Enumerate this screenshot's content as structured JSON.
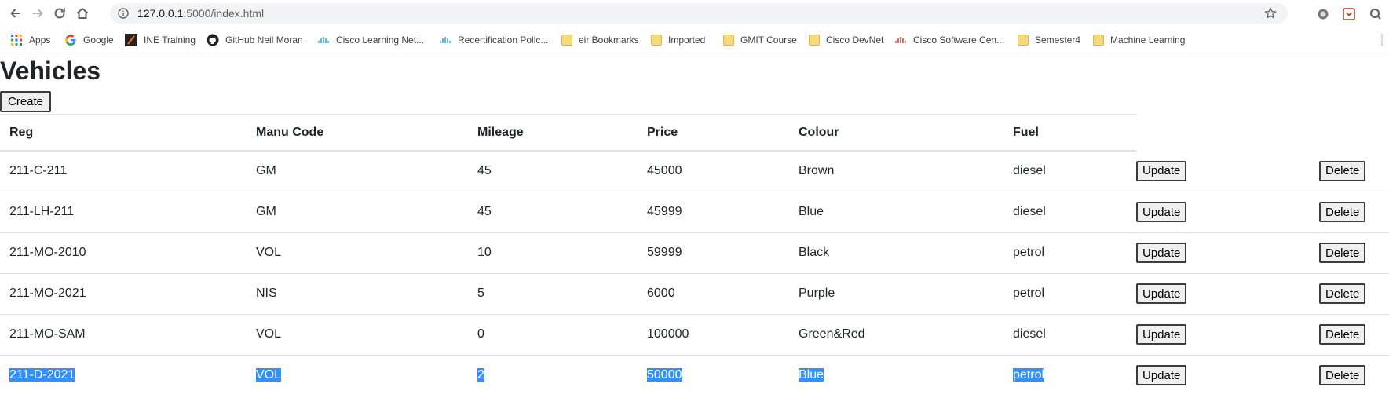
{
  "browser": {
    "url_host": "127.0.0.1",
    "url_rest": ":5000/index.html",
    "bookmarks": [
      {
        "label": "Apps",
        "icon": "apps-grid-icon"
      },
      {
        "label": "Google",
        "icon": "google-icon"
      },
      {
        "label": "INE Training",
        "icon": "ine-icon"
      },
      {
        "label": "GitHub Neil Moran",
        "icon": "github-icon"
      },
      {
        "label": "Cisco Learning Net...",
        "icon": "cisco-icon"
      },
      {
        "label": "Recertification Polic...",
        "icon": "cisco-icon"
      },
      {
        "label": "eir Bookmarks",
        "icon": "folder-icon"
      },
      {
        "label": "Imported",
        "icon": "folder-icon"
      },
      {
        "label": "GMIT Course",
        "icon": "folder-icon"
      },
      {
        "label": "Cisco DevNet",
        "icon": "folder-icon"
      },
      {
        "label": "Cisco Software Cen...",
        "icon": "cisco-icon"
      },
      {
        "label": "Semester4",
        "icon": "folder-icon"
      },
      {
        "label": "Machine Learning",
        "icon": "folder-icon"
      }
    ]
  },
  "page": {
    "title": "Vehicles",
    "create_label": "Create",
    "columns": [
      "Reg",
      "Manu Code",
      "Mileage",
      "Price",
      "Colour",
      "Fuel"
    ],
    "update_label": "Update",
    "delete_label": "Delete",
    "rows": [
      {
        "reg": "211-C-211",
        "manu": "GM",
        "mileage": "45",
        "price": "45000",
        "colour": "Brown",
        "fuel": "diesel"
      },
      {
        "reg": "211-LH-211",
        "manu": "GM",
        "mileage": "45",
        "price": "45999",
        "colour": "Blue",
        "fuel": "diesel"
      },
      {
        "reg": "211-MO-2010",
        "manu": "VOL",
        "mileage": "10",
        "price": "59999",
        "colour": "Black",
        "fuel": "petrol"
      },
      {
        "reg": "211-MO-2021",
        "manu": "NIS",
        "mileage": "5",
        "price": "6000",
        "colour": "Purple",
        "fuel": "petrol"
      },
      {
        "reg": "211-MO-SAM",
        "manu": "VOL",
        "mileage": "0",
        "price": "100000",
        "colour": "Green&Red",
        "fuel": "diesel"
      },
      {
        "reg": "211-D-2021",
        "manu": "VOL",
        "mileage": "2",
        "price": "50000",
        "colour": "Blue",
        "fuel": "petrol"
      }
    ],
    "selected_row_index": 5
  },
  "colors": {
    "selection": "#3390ff",
    "border": "#dee2e6"
  }
}
